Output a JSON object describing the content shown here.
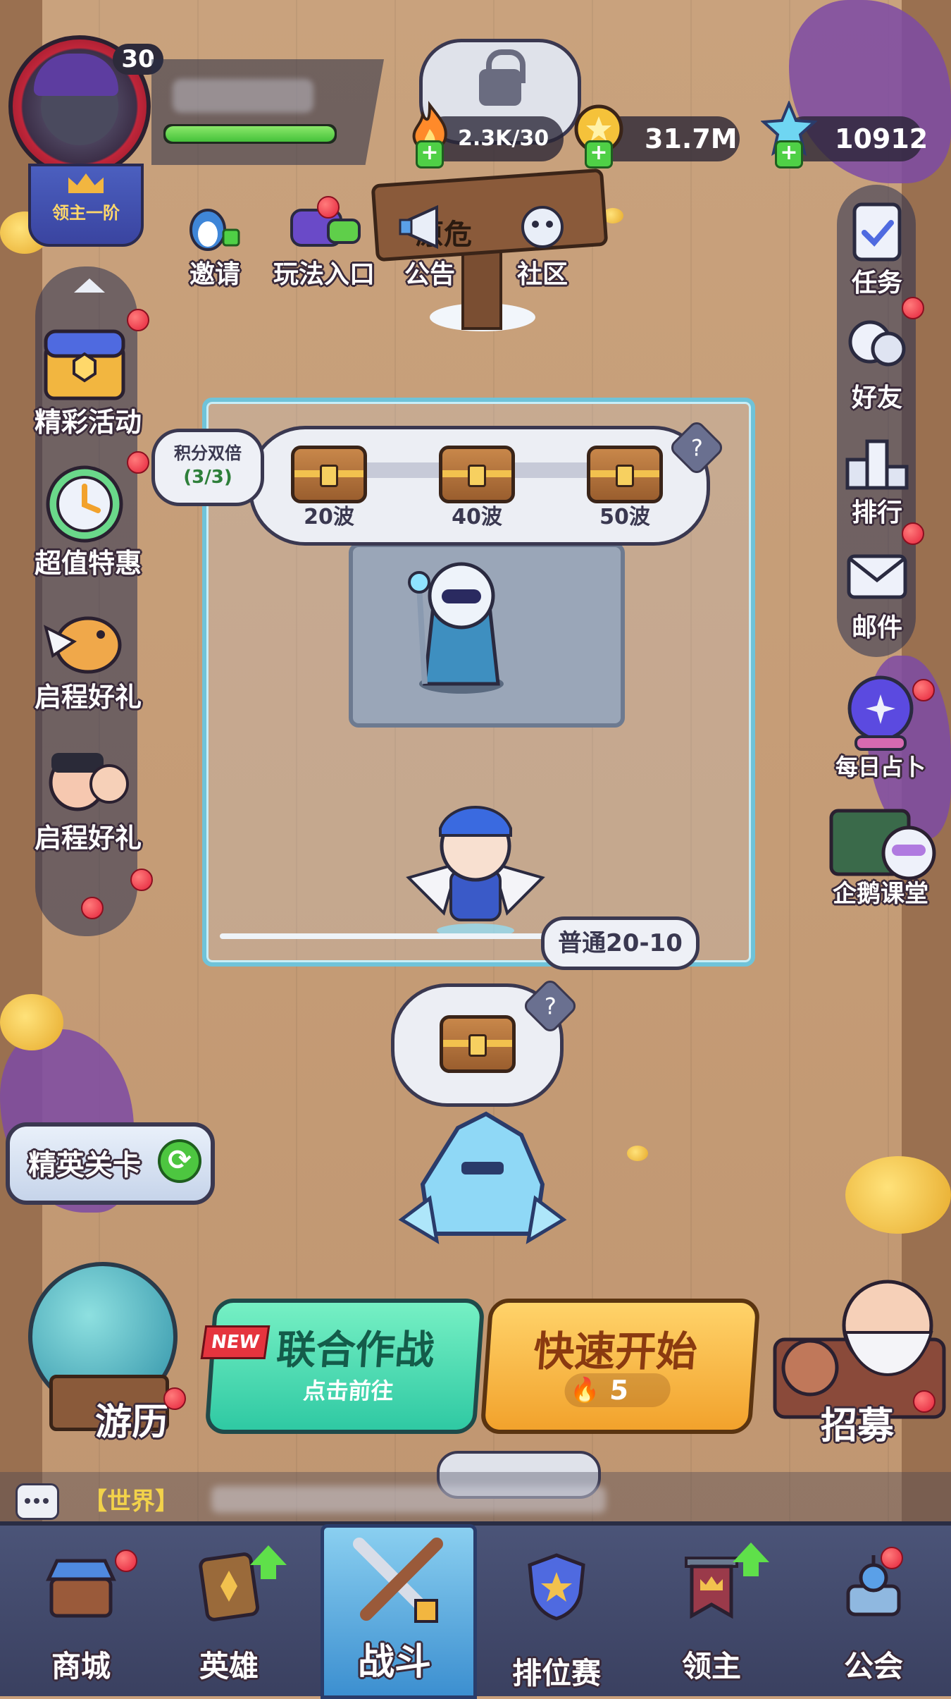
{
  "player": {
    "level": "30",
    "rank_title": "领主一阶"
  },
  "resources": {
    "energy": "2.3K/30",
    "gold": "31.7M",
    "gems": "10912"
  },
  "sign_text": "原危",
  "top_shortcuts": [
    {
      "label": "邀请",
      "icon": "penguin-invite-icon"
    },
    {
      "label": "玩法入口",
      "icon": "gamepad-icon"
    },
    {
      "label": "公告",
      "icon": "megaphone-icon"
    },
    {
      "label": "社区",
      "icon": "community-icon"
    }
  ],
  "left_menu": [
    {
      "label": "精彩活动",
      "icon": "treasure-chest-icon"
    },
    {
      "label": "超值特惠",
      "icon": "clock-icon"
    },
    {
      "label": "启程好礼",
      "icon": "griffin-icon"
    },
    {
      "label": "启程好礼",
      "icon": "heroes-icon"
    }
  ],
  "right_menu": [
    {
      "label": "任务",
      "icon": "clipboard-icon"
    },
    {
      "label": "好友",
      "icon": "friends-icon"
    },
    {
      "label": "排行",
      "icon": "podium-icon"
    },
    {
      "label": "邮件",
      "icon": "mail-icon"
    }
  ],
  "right_extras": [
    {
      "label": "每日占卜",
      "icon": "crystal-ball-icon"
    },
    {
      "label": "企鹅课堂",
      "icon": "blackboard-icon"
    }
  ],
  "stage": {
    "double_badge_line1": "积分双倍",
    "double_badge_line2": "(3/3)",
    "rewards": [
      {
        "wave": "20波"
      },
      {
        "wave": "40波"
      },
      {
        "wave": "50波"
      }
    ],
    "help": "?",
    "stage_name": "普通20-10"
  },
  "next_chest_help": "?",
  "elite": {
    "label": "精英关卡",
    "refresh": "⟳"
  },
  "travel_label": "游历",
  "coop": {
    "new_tag": "NEW",
    "title": "联合作战",
    "subtitle": "点击前往"
  },
  "quick_start": {
    "title": "快速开始",
    "cost": "5"
  },
  "recruit_label": "招募",
  "chat": {
    "channel": "【世界】"
  },
  "nav": [
    {
      "label": "商城",
      "icon": "shop-icon"
    },
    {
      "label": "英雄",
      "icon": "hero-card-icon"
    },
    {
      "label": "战斗",
      "icon": "crossed-swords-icon"
    },
    {
      "label": "排位赛",
      "icon": "ranked-shield-icon"
    },
    {
      "label": "领主",
      "icon": "lord-banner-icon"
    },
    {
      "label": "公会",
      "icon": "guild-icon"
    }
  ],
  "colors": {
    "accent_green": "#4fd046",
    "notification_red": "#e5233b",
    "coop_button": "#2fc9a3",
    "quick_button": "#f2a22c"
  }
}
